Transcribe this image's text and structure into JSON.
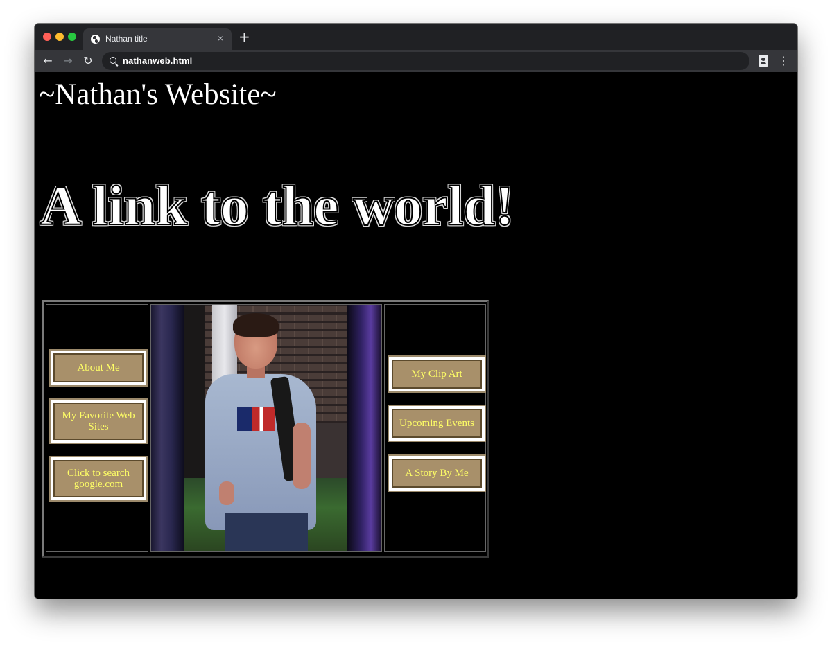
{
  "browser": {
    "tab_title": "Nathan title",
    "tab_close": "×",
    "new_tab": "+",
    "url": "nathanweb.html",
    "nav": {
      "back": "←",
      "forward": "→",
      "reload": "↻",
      "menu": "⋮"
    }
  },
  "page": {
    "site_title": "~Nathan's Website~",
    "headline": "A link to the world!",
    "left_links": [
      {
        "label": "About Me"
      },
      {
        "label": "My Favorite Web Sites"
      },
      {
        "label": "Click to search google.com"
      }
    ],
    "right_links": [
      {
        "label": "My Clip Art"
      },
      {
        "label": "Upcoming Events"
      },
      {
        "label": "A Story By Me"
      }
    ]
  },
  "colors": {
    "page_background": "#000000",
    "button_text": "#ffff66",
    "button_fill": "#a8906a",
    "text": "#ffffff"
  }
}
